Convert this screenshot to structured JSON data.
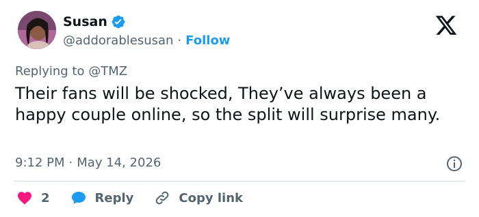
{
  "tweet": {
    "author_name": "Susan",
    "author_handle": "@addorablesusan",
    "separator": "·",
    "follow_label": "Follow",
    "replying_prefix": "Replying to",
    "replying_to": "@TMZ",
    "text": "Their fans will be shocked, They’ve always been a happy couple online, so the split will surprise many.",
    "time": "9:12 PM",
    "date": "May 14, 2026",
    "time_separator": "·",
    "likes": "2",
    "reply_label": "Reply",
    "copy_label": "Copy link"
  },
  "colors": {
    "accent": "#1d9bf0",
    "secondary_text": "#536471",
    "like": "#f91880",
    "divider": "#cfd9de"
  },
  "icons": [
    "verified-badge-icon",
    "x-logo-icon",
    "info-icon",
    "heart-icon",
    "reply-bubble-icon",
    "link-icon"
  ]
}
